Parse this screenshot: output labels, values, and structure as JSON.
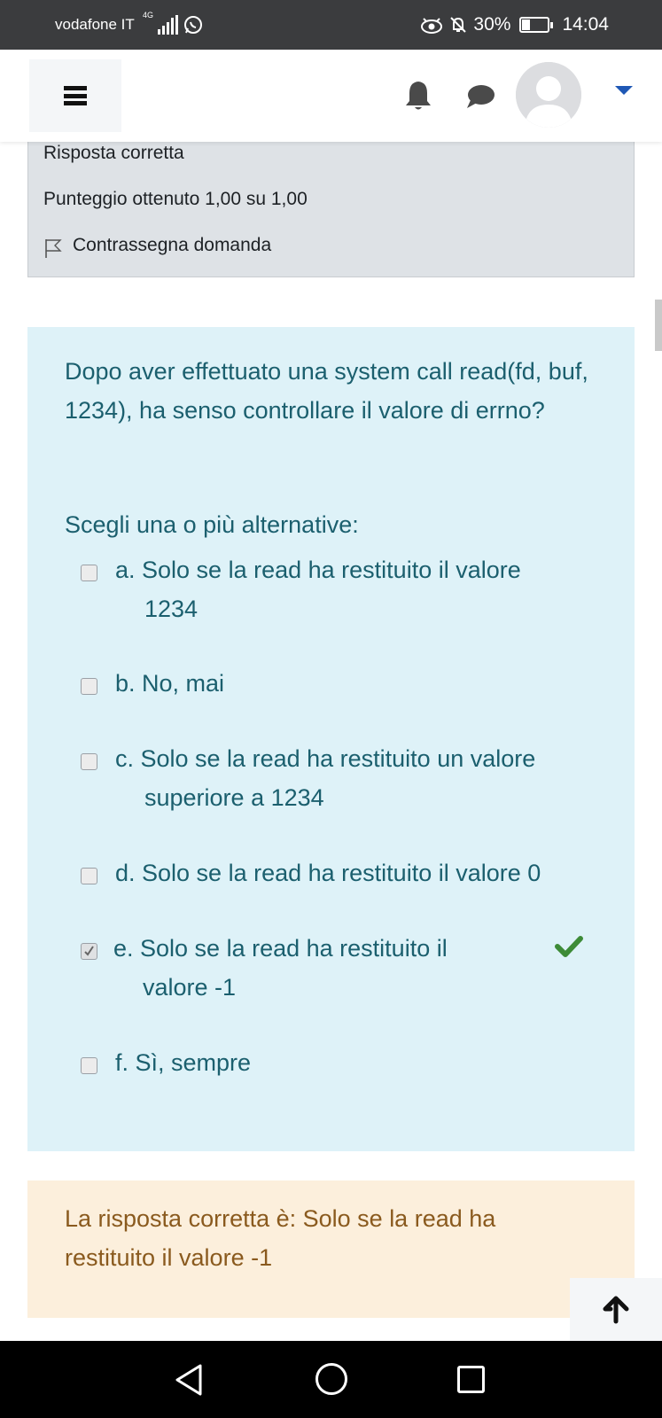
{
  "status_bar": {
    "carrier": "vodafone IT",
    "network": "4G",
    "battery": "30%",
    "time": "14:04",
    "icons": [
      "signal-icon",
      "whatsapp-icon",
      "eye-icon",
      "alarm-off-icon",
      "battery-icon"
    ]
  },
  "navbar": {
    "icons": [
      "hamburger-menu-icon",
      "bell-icon",
      "chat-icon",
      "avatar",
      "caret-down-icon"
    ]
  },
  "previous_question": {
    "state": "Risposta corretta",
    "grade": "Punteggio ottenuto 1,00 su 1,00",
    "flag_label": "Contrassegna domanda"
  },
  "question": {
    "text": "Dopo aver effettuato una system call read(fd, buf, 1234), ha senso controllare il valore di errno?",
    "prompt": "Scegli una o più alternative:",
    "answers": [
      {
        "line1": "a. Solo se la read ha restituito il valore",
        "line2": "1234",
        "checked": false
      },
      {
        "line1": "b. No, mai",
        "line2": "",
        "checked": false
      },
      {
        "line1": "c. Solo se la read ha restituito un valore",
        "line2": "superiore a 1234",
        "checked": false
      },
      {
        "line1": "d. Solo se la read ha restituito il valore 0",
        "line2": "",
        "checked": false
      },
      {
        "line1": "e. Solo se la read ha restituito il",
        "line2": "valore -1",
        "checked": true,
        "correct": true
      },
      {
        "line1": "f. Sì, sempre",
        "line2": "",
        "checked": false
      }
    ]
  },
  "feedback": {
    "text": "La risposta corretta è: Solo se la read ha restituito il valore -1"
  },
  "colors": {
    "question_bg": "#def2f8",
    "question_text": "#1b5f6e",
    "feedback_bg": "#fcefdc",
    "feedback_text": "#8a5a1e",
    "correct": "#3d8b37",
    "accent": "#1f58b5"
  }
}
